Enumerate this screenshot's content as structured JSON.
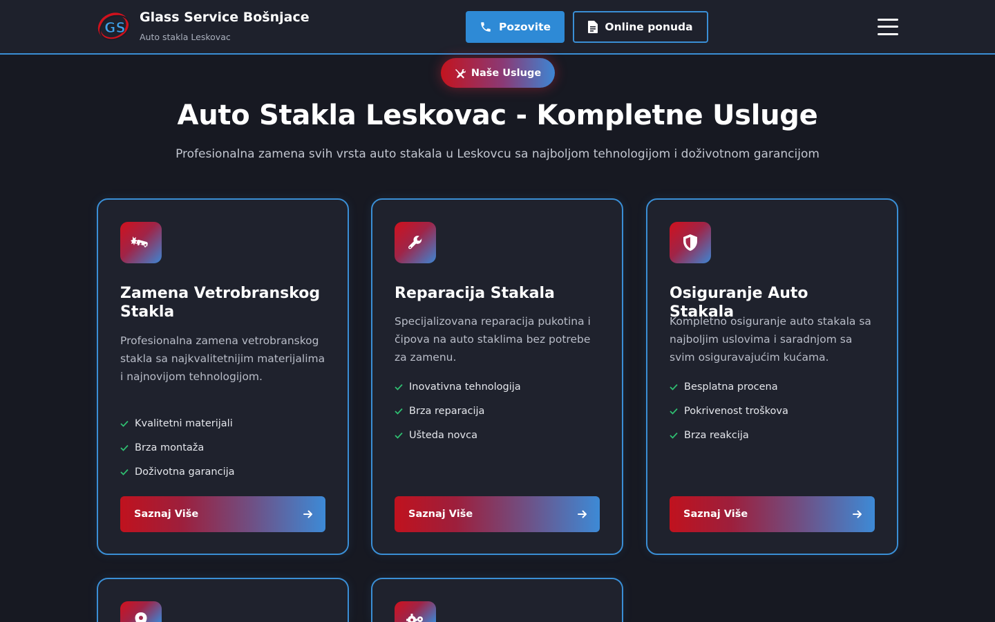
{
  "header": {
    "brand_title": "Glass Service Bošnjace",
    "brand_subtitle": "Auto stakla Leskovac",
    "logo_text": "GS",
    "call_label": "Pozovite",
    "quote_label": "Online ponuda"
  },
  "section": {
    "pill_label": "Naše Usluge",
    "title": "Auto Stakla Leskovac - Kompletne Usluge",
    "subtitle": "Profesionalna zamena svih vrsta auto stakala u Leskovcu sa najboljom tehnologijom i doživotnom garancijom"
  },
  "cards": [
    {
      "icon": "car-crash-icon",
      "title": "Zamena Vetrobranskog Stakla",
      "description": "Profesionalna zamena vetrobranskog stakla sa najkvalitetnijim materijalima i najnovijom tehnologijom.",
      "features": [
        "Kvalitetni materijali",
        "Brza montaža",
        "Doživotna garancija"
      ],
      "button_label": "Saznaj Više"
    },
    {
      "icon": "wrench-icon",
      "title": "Reparacija Stakala",
      "description": "Specijalizovana reparacija pukotina i čipova na auto staklima bez potrebe za zamenu.",
      "features": [
        "Inovativna tehnologija",
        "Brza reparacija",
        "Ušteda novca"
      ],
      "button_label": "Saznaj Više"
    },
    {
      "icon": "shield-icon",
      "title": "Osiguranje Auto Stakala",
      "description": "Kompletno osiguranje auto stakala sa najboljim uslovima i saradnjom sa svim osiguravajućim kućama.",
      "features": [
        "Besplatna procena",
        "Pokrivenost troškova",
        "Brza reakcija"
      ],
      "button_label": "Saznaj Više"
    },
    {
      "icon": "map-pin-icon"
    },
    {
      "icon": "cogs-icon"
    }
  ],
  "colors": {
    "background": "#171922",
    "header_bg": "#1e212c",
    "card_bg": "#1f222d",
    "accent_blue": "#3a8fd6",
    "accent_red": "#c3141f",
    "check_green": "#2fbf71"
  }
}
